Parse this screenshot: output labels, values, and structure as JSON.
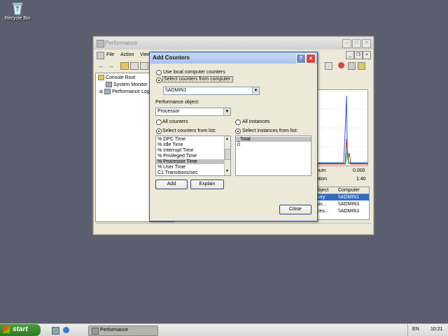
{
  "desktop": {
    "recycle_bin_label": "Recycle Bin"
  },
  "perf_window": {
    "title": "Performance",
    "menu": [
      "File",
      "Action",
      "View"
    ],
    "tree": [
      "Console Root",
      "System Monitor",
      "Performance Logs"
    ],
    "stats": {
      "min_label": "num",
      "min_value": "0.000",
      "dur_label": "ation",
      "dur_value": "1:40"
    },
    "grid": {
      "headers": [
        "Object",
        "Computer"
      ],
      "rows": [
        [
          "mory",
          "\\\\ADMIN1"
        ],
        [
          "ysic...",
          "\\\\ADMIN1"
        ],
        [
          "oces...",
          "\\\\ADMIN1"
        ]
      ]
    }
  },
  "dialog": {
    "title": "Add Counters",
    "use_local": "Use local computer counters",
    "select_from_computer": "Select counters from computer:",
    "computer_value": "\\\\ADMIN1",
    "perf_object_label": "Performance object:",
    "perf_object_value": "Processor",
    "all_counters": "All counters",
    "select_counters": "Select counters from list:",
    "all_instances": "All instances",
    "select_instances": "Select instances from list:",
    "counters": [
      "% DPC Time",
      "% Idle Time",
      "% Interrupt Time",
      "% Privileged Time",
      "% Processor Time",
      "% User Time",
      "C1 Transitions/sec"
    ],
    "selected_counter": "% Processor Time",
    "instances": [
      "_Total",
      "0"
    ],
    "add_label": "Add",
    "explain_label": "Explain",
    "close_label": "Close"
  },
  "taskbar": {
    "start_label": "start",
    "task_label": "Performance",
    "lang": "EN",
    "clock": "10:21"
  },
  "colors": {
    "desktop": "#5b5e6e",
    "dialog_title": "#a9c2ef",
    "close_red": "#d9473a",
    "start_green": "#3a8a2e"
  }
}
